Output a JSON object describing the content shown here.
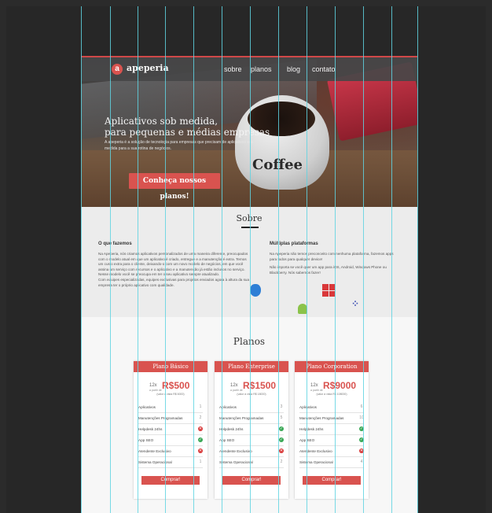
{
  "brand": {
    "mark": "a",
    "name": "apeperia"
  },
  "nav": [
    "sobre",
    "planos",
    "blog",
    "contato"
  ],
  "hero": {
    "title_line1": "Aplicativos sob medida,",
    "title_line2": "para pequenas e médias empresas",
    "desc": "A apeperia é a solução de tecnologia para empresas que precisam de aplicativos sob medida para a sua rotina de negócios.",
    "cta": "Conheça nossos planos!",
    "cup_text": "Coffee"
  },
  "sobre": {
    "title": "Sobre",
    "left_title": "O que fazemos",
    "left_text1": "Na Apeperia, nós criamos aplicativos personalizados de uma maneira diferente, preocupados com o modelo atual em que um aplicativo é criado, entregue e a manutenção é extra. Temos um custo extra para o cliente, deixando-o com um novo modelo de negócios, em que você assina um serviço com recursos e o aplicativo e a manutenção já estão inclusos no serviço. Nesse modelo você se preocupa em ter o seu aplicativo sempre atualizado.",
    "left_text2": "Com equipes especializadas, equipes exclusivas para projetos enviados agora à altura da sua empresa ter o próprio aplicativo com qualidade.",
    "right_title": "Múltiplas plataformas",
    "right_text1": "Na Apeperia não temos preconceito com nenhuma plataforma, fazemos apps para todos para qualquer device!",
    "right_text2": "Não importa se você quer um app para iOS, Android, Windows Phone ou Blackberry. Nós sabemos fazer!"
  },
  "planos": {
    "title": "Planos",
    "cards": [
      {
        "name": "Plano Básico",
        "prefix": "12x",
        "small": "a partir de",
        "price": "R$500",
        "note": "(valor à vista R$ 6000)",
        "features": [
          "Aplicativos",
          "Manutenções Programadas",
          "Helpdesk 24hs",
          "App SEO",
          "Atendente Exclusivo",
          "Sistema Operacional"
        ],
        "marks": [
          "1",
          "2",
          "✕",
          "✓",
          "✕",
          "1"
        ],
        "buy": "Comprar!"
      },
      {
        "name": "Plano Enterprise",
        "prefix": "12x",
        "small": "a partir de",
        "price": "R$1500",
        "note": "(valor à vista R$ 18000)",
        "features": [
          "Aplicativos",
          "Manutenções Programadas",
          "Helpdesk 24hs",
          "App SEO",
          "Atendente Exclusivo",
          "Sistema Operacional"
        ],
        "marks": [
          "3",
          "5",
          "✓",
          "✓",
          "✕",
          "2"
        ],
        "buy": "Comprar!"
      },
      {
        "name": "Plano Corporation",
        "prefix": "12x",
        "small": "a partir de",
        "price": "R$9000",
        "note": "(valor à vista R$ 108000)",
        "features": [
          "Aplicativos",
          "Manutenções Programadas",
          "Helpdesk 24hs",
          "App SEO",
          "Atendente Exclusivo",
          "Sistema Operacional"
        ],
        "marks": [
          "6",
          "10",
          "✓",
          "✓",
          "✕",
          "4"
        ],
        "buy": "Comprar!"
      }
    ]
  },
  "colors": {
    "accent": "#d9534f",
    "guide": "#5fd3e2"
  }
}
